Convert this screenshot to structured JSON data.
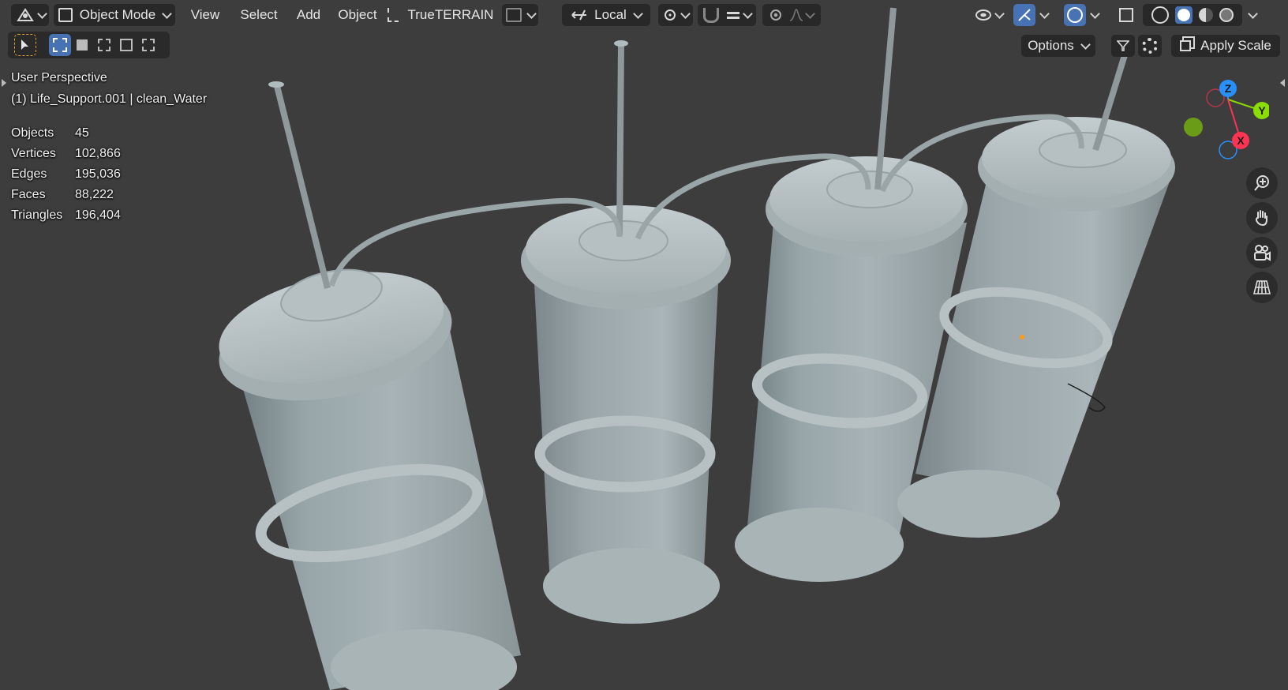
{
  "header": {
    "editor_type_icon": "3d-viewport-icon",
    "mode_label": "Object Mode",
    "menu": {
      "view": "View",
      "select": "Select",
      "add": "Add",
      "object": "Object"
    },
    "addon_label": "TrueTERRAIN",
    "transform_orientation": "Local"
  },
  "tool_header": {
    "options_label": "Options",
    "apply_scale_label": "Apply Scale"
  },
  "overlay_info": {
    "view_name": "User Perspective",
    "object_context": "(1) Life_Support.001 | clean_Water",
    "stats": [
      {
        "label": "Objects",
        "value": "45"
      },
      {
        "label": "Vertices",
        "value": "102,866"
      },
      {
        "label": "Edges",
        "value": "195,036"
      },
      {
        "label": "Faces",
        "value": "88,222"
      },
      {
        "label": "Triangles",
        "value": "196,404"
      }
    ]
  },
  "gizmo": {
    "z": "Z",
    "y": "Y",
    "x": "X"
  },
  "colors": {
    "accent": "#4772b3",
    "viewport_bg": "#3d3d3d",
    "header_bg": "#282828",
    "axis_x": "#ff3352",
    "axis_y": "#8bdc00",
    "axis_z": "#2890ff",
    "object_origin": "#ff9a1a"
  }
}
